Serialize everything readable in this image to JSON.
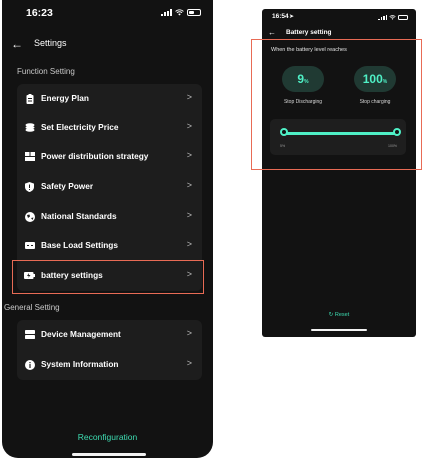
{
  "left_screen": {
    "status_time": "16:23",
    "back_icon": "arrow-left-icon",
    "title": "Settings",
    "function_section_label": "Function Setting",
    "function_items": [
      {
        "label": "Energy Plan",
        "icon": "energy-plan-icon"
      },
      {
        "label": "Set Electricity Price",
        "icon": "coins-icon"
      },
      {
        "label": "Power distribution strategy",
        "icon": "grid-icon"
      },
      {
        "label": "Safety Power",
        "icon": "shield-icon"
      },
      {
        "label": "National Standards",
        "icon": "globe-icon"
      },
      {
        "label": "Base Load Settings",
        "icon": "battery-bar-icon"
      },
      {
        "label": "battery settings",
        "icon": "battery-icon"
      }
    ],
    "general_section_label": "General Setting",
    "general_items": [
      {
        "label": "Device Management",
        "icon": "server-icon"
      },
      {
        "label": "System Information",
        "icon": "info-icon"
      }
    ],
    "chevron": ">",
    "bottom_action": "Reconfiguration"
  },
  "right_screen": {
    "status_time": "16:54",
    "title": "Battery setting",
    "caption": "When the battery level reaches",
    "stop_discharging": {
      "value": "9",
      "unit": "%",
      "label": "Stop Discharging"
    },
    "stop_charging": {
      "value": "100",
      "unit": "%",
      "label": "Stop charging"
    },
    "slider": {
      "min_label": "5%",
      "max_label": "100%",
      "low": 5,
      "high": 100
    },
    "reset_label": "Reset"
  },
  "colors": {
    "background": "#121212",
    "card": "#1d1d1d",
    "accent": "#3ddcb1",
    "highlight": "#e86b55"
  }
}
